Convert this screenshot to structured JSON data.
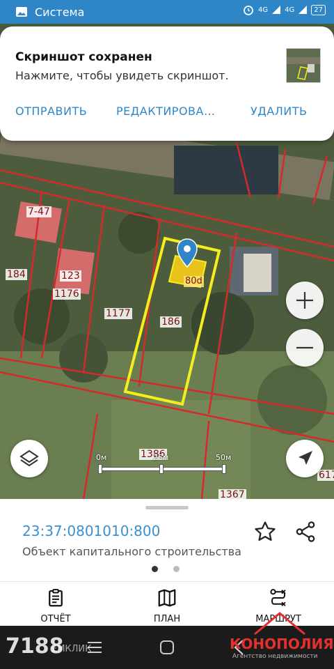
{
  "status_bar": {
    "app_name": "Система",
    "network": "4G",
    "network2": "4G",
    "battery": "27"
  },
  "notification": {
    "title": "Скриншот сохранен",
    "subtitle": "Нажмите, чтобы увидеть скриншот.",
    "actions": [
      "ОТПРАВИТЬ",
      "РЕДАКТИРОВА…",
      "УДАЛИТЬ"
    ]
  },
  "map": {
    "lots": [
      "7-47",
      "184",
      "123",
      "1176",
      "1177",
      "186",
      "80d",
      "1386",
      "1367",
      "617"
    ],
    "scale": {
      "labels": [
        "0м",
        "25м",
        "50м"
      ]
    }
  },
  "details": {
    "cadastral_number": "23:37:0801010:800",
    "object_type": "Объект капитального строительства",
    "page_count": 2,
    "active_page": 1
  },
  "tabs": [
    {
      "label": "ОТЧЁТ",
      "icon": "report-icon"
    },
    {
      "label": "ПЛАН",
      "icon": "map-plan-icon"
    },
    {
      "label": "МАРШРУТ",
      "icon": "route-icon"
    }
  ],
  "watermarks": {
    "left": "7188",
    "left_sub": "ЕМКЛИК",
    "right": "КОНОПОЛИЯ",
    "right_sub": "Агентство недвижимости"
  },
  "colors": {
    "status_bar": "#2e86c7",
    "accent_blue": "#3c8fcf",
    "plot_outline": "#f4ef1c",
    "boundary_red": "#d62a2a"
  }
}
